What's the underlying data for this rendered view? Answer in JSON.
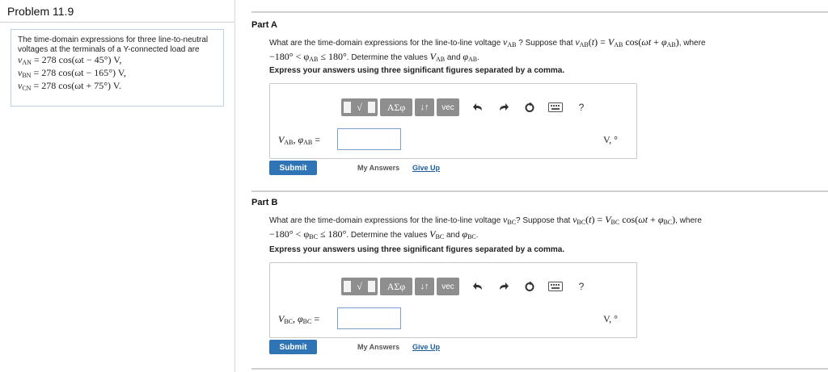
{
  "problem": {
    "title": "Problem 11.9",
    "statement_text": "The time-domain expressions for three line-to-neutral voltages at the terminals of a Y-connected load are",
    "voltages": [
      {
        "symbol": "v",
        "sub": "AN",
        "expr": " = 278 cos(ωt − 45°) V,"
      },
      {
        "symbol": "v",
        "sub": "BN",
        "expr": " = 278 cos(ωt − 165°) V,"
      },
      {
        "symbol": "v",
        "sub": "CN",
        "expr": " = 278 cos(ωt + 75°) V."
      }
    ]
  },
  "parts": [
    {
      "title": "Part A",
      "q_prefix": "What are the time-domain expressions for the line-to-line voltage ",
      "q_sub": "AB",
      "q_mid": " ? Suppose that ",
      "q_where": ", where",
      "q_range": "−180° < φ",
      "q_range_end": " ≤ 180°",
      "q_determine": ". Determine the values ",
      "q_and": " and ",
      "instruction": "Express your answers using three significant figures separated by a comma.",
      "answer_label_sub": "AB",
      "input_value": "",
      "units": "V, °",
      "submit": "Submit",
      "my_answers": "My Answers",
      "give_up": "Give Up"
    },
    {
      "title": "Part B",
      "q_prefix": "What are the time-domain expressions for the line-to-line voltage ",
      "q_sub": "BC",
      "q_mid": "? Suppose that ",
      "q_where": ", where",
      "q_range": "−180° < φ",
      "q_range_end": " ≤ 180°",
      "q_determine": ". Determine the values ",
      "q_and": " and ",
      "instruction": "Express your answers using three significant figures separated by a comma.",
      "answer_label_sub": "BC",
      "input_value": "",
      "units": "V, °",
      "submit": "Submit",
      "my_answers": "My Answers",
      "give_up": "Give Up"
    }
  ],
  "toolbar": {
    "templates_label": "√",
    "greek_label": "ΑΣφ",
    "arrows_label": "↓↑",
    "vec_label": "vec",
    "help_label": "?"
  },
  "colors": {
    "accent": "#2f74b5",
    "toolbar_gray": "#8e8e8e",
    "link": "#1a5d9e"
  }
}
